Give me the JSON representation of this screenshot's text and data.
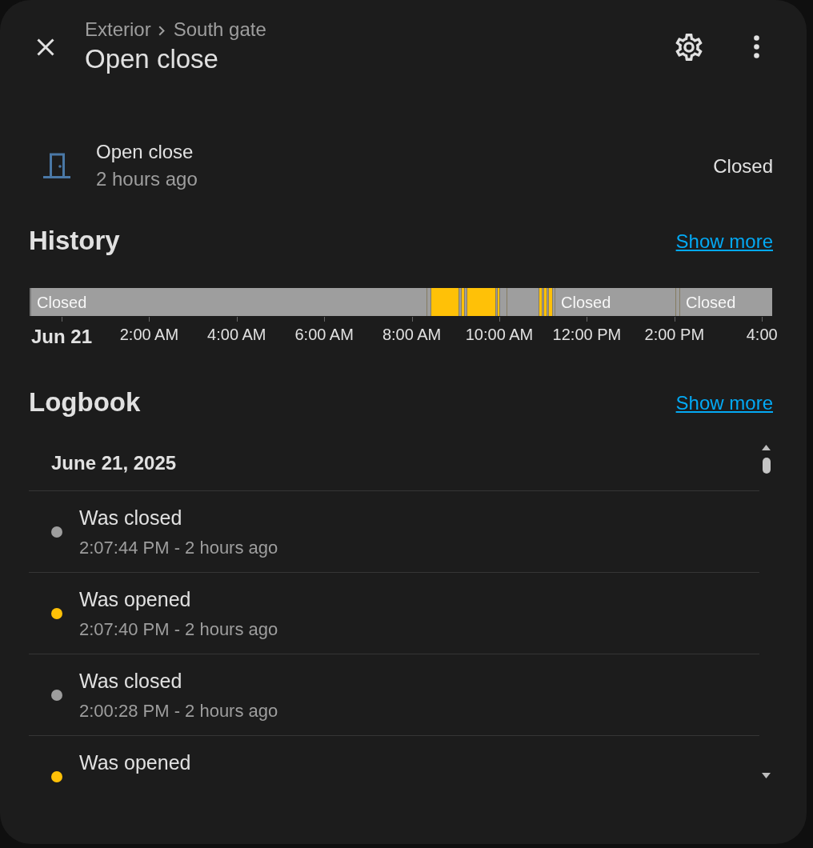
{
  "header": {
    "breadcrumb": [
      "Exterior",
      "South gate"
    ],
    "title": "Open close"
  },
  "entity": {
    "name": "Open close",
    "last_changed": "2 hours ago",
    "state": "Closed"
  },
  "history": {
    "title": "History",
    "show_more": "Show more",
    "segments": [
      {
        "color": "#9e9e9e",
        "label": "Closed"
      },
      {
        "color": "#9e9e9e"
      },
      {
        "color": "#ffc107"
      },
      {
        "color": "#9e9e9e"
      },
      {
        "color": "#ffc107"
      },
      {
        "color": "#9e9e9e"
      },
      {
        "color": "#ffc107"
      },
      {
        "color": "#9e9e9e"
      },
      {
        "color": "#ffc107"
      },
      {
        "color": "#9e9e9e"
      },
      {
        "color": "#9e9e9e"
      },
      {
        "color": "#ffc107"
      },
      {
        "color": "#9e9e9e"
      },
      {
        "color": "#ffc107"
      },
      {
        "color": "#9e9e9e"
      },
      {
        "color": "#ffc107"
      },
      {
        "color": "#9e9e9e"
      },
      {
        "color": "#9e9e9e",
        "label": "Closed"
      },
      {
        "color": "#9e9e9e"
      },
      {
        "color": "#9e9e9e",
        "label": "Closed"
      }
    ],
    "axis_labels": [
      {
        "label": "Jun 21",
        "kind": "date"
      },
      {
        "label": "2:00 AM",
        "kind": "time"
      },
      {
        "label": "4:00 AM",
        "kind": "time"
      },
      {
        "label": "6:00 AM",
        "kind": "time"
      },
      {
        "label": "8:00 AM",
        "kind": "time"
      },
      {
        "label": "10:00 AM",
        "kind": "time"
      },
      {
        "label": "12:00 PM",
        "kind": "time"
      },
      {
        "label": "2:00 PM",
        "kind": "time"
      },
      {
        "label": "4:00",
        "kind": "time"
      }
    ]
  },
  "logbook": {
    "title": "Logbook",
    "show_more": "Show more",
    "date": "June 21, 2025",
    "entries": [
      {
        "message": "Was closed",
        "time": "2:07:44 PM - 2 hours ago",
        "color": "#9e9e9e"
      },
      {
        "message": "Was opened",
        "time": "2:07:40 PM - 2 hours ago",
        "color": "#ffc107"
      },
      {
        "message": "Was closed",
        "time": "2:00:28 PM - 2 hours ago",
        "color": "#9e9e9e"
      },
      {
        "message": "Was opened",
        "color": "#ffc107"
      }
    ]
  }
}
